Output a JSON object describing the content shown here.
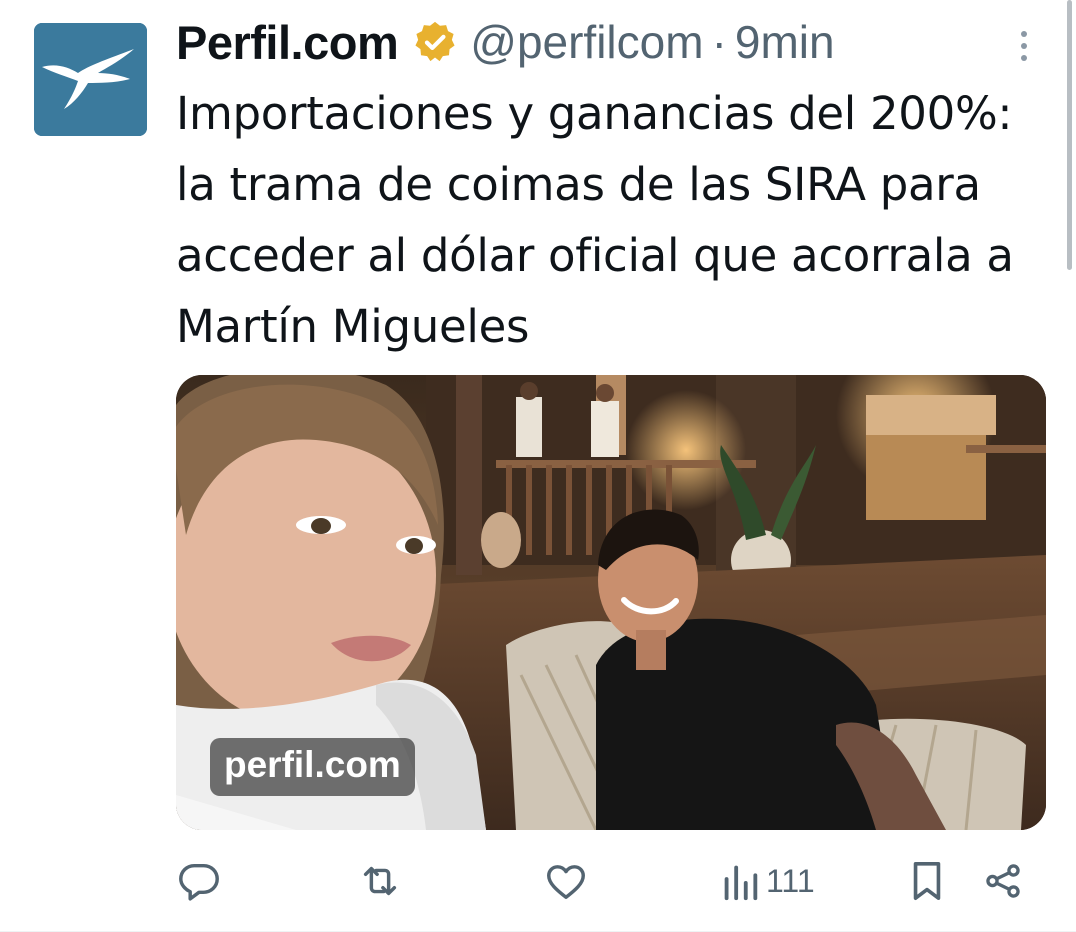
{
  "tweet": {
    "author": {
      "display_name": "Perfil.com",
      "handle": "@perfilcom",
      "verified_badge": "verified-gold-icon",
      "avatar_icon": "bird-logo-icon"
    },
    "separator": "·",
    "time": "9min",
    "text": "Importaciones y ganancias del 200%: la trama de coimas de las SIRA para acceder al dólar oficial que acorrala a Martín Migueles",
    "media": {
      "watermark": "perfil.com"
    },
    "actions": {
      "reply_icon": "reply-icon",
      "retweet_icon": "retweet-icon",
      "like_icon": "heart-icon",
      "views_icon": "views-chart-icon",
      "views_count": "111",
      "bookmark_icon": "bookmark-icon",
      "share_icon": "share-icon"
    }
  },
  "colors": {
    "text_primary": "#0f1419",
    "text_secondary": "#536471",
    "avatar_bg": "#3b7a9d",
    "verified_gold": "#e8b12f"
  }
}
